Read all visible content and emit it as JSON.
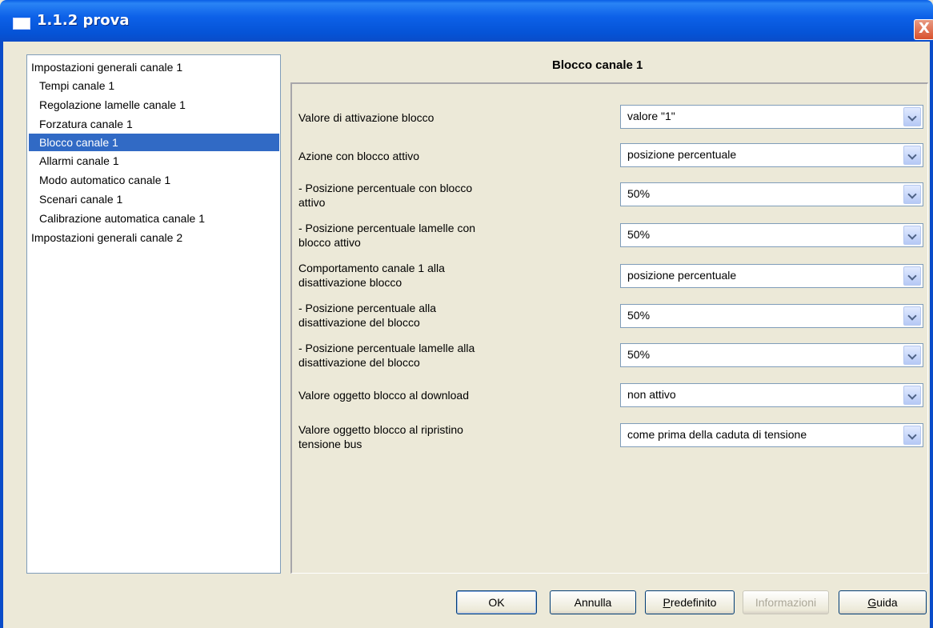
{
  "window": {
    "title": "1.1.2 prova",
    "close_label": "X"
  },
  "tree": {
    "items": [
      {
        "label": "Impostazioni generali canale 1",
        "level": 0,
        "selected": false
      },
      {
        "label": "Tempi canale 1",
        "level": 1,
        "selected": false
      },
      {
        "label": "Regolazione lamelle canale 1",
        "level": 1,
        "selected": false
      },
      {
        "label": "Forzatura canale 1",
        "level": 1,
        "selected": false
      },
      {
        "label": "Blocco canale 1",
        "level": 1,
        "selected": true
      },
      {
        "label": "Allarmi canale 1",
        "level": 1,
        "selected": false
      },
      {
        "label": "Modo automatico canale 1",
        "level": 1,
        "selected": false
      },
      {
        "label": "Scenari canale 1",
        "level": 1,
        "selected": false
      },
      {
        "label": "Calibrazione automatica canale 1",
        "level": 1,
        "selected": false
      },
      {
        "label": "Impostazioni generali canale 2",
        "level": 0,
        "selected": false
      }
    ]
  },
  "panel": {
    "title": "Blocco canale 1",
    "params": [
      {
        "label": "Valore di attivazione blocco",
        "value": "valore \"1\""
      },
      {
        "label": "Azione con blocco attivo",
        "value": "posizione percentuale"
      },
      {
        "label": "- Posizione percentuale con blocco\n  attivo",
        "value": "50%"
      },
      {
        "label": "- Posizione percentuale lamelle con\n  blocco attivo",
        "value": "50%"
      },
      {
        "label": "Comportamento canale 1 alla\ndisattivazione blocco",
        "value": "posizione percentuale"
      },
      {
        "label": "- Posizione percentuale alla\n  disattivazione del blocco",
        "value": "50%"
      },
      {
        "label": "- Posizione percentuale lamelle alla\n  disattivazione del blocco",
        "value": "50%"
      },
      {
        "label": "Valore oggetto blocco al download",
        "value": "non attivo"
      },
      {
        "label": "Valore oggetto blocco al ripristino\ntensione bus",
        "value": "come prima della caduta di tensione"
      }
    ]
  },
  "buttons": {
    "ok": "OK",
    "annulla": "Annulla",
    "predefinito_first": "P",
    "predefinito_rest": "redefinito",
    "informazioni": "Informazioni",
    "guida_first": "G",
    "guida_rest": "uida"
  },
  "colors": {
    "selection": "#316ac5",
    "titlebar": "#0553d6",
    "dialog_bg": "#ece9d8"
  }
}
